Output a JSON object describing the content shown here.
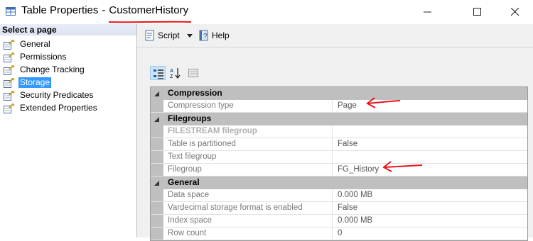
{
  "window": {
    "title_prefix": "Table Properties",
    "title_separator": "-",
    "title_object": "CustomerHistory"
  },
  "left_panel": {
    "header": "Select a page",
    "items": [
      {
        "label": "General",
        "icon": "wrench-page-icon",
        "selected": false
      },
      {
        "label": "Permissions",
        "icon": "wrench-page-icon",
        "selected": false
      },
      {
        "label": "Change Tracking",
        "icon": "wrench-page-icon",
        "selected": false
      },
      {
        "label": "Storage",
        "icon": "wrench-page-icon",
        "selected": true
      },
      {
        "label": "Security Predicates",
        "icon": "wrench-page-icon",
        "selected": false
      },
      {
        "label": "Extended Properties",
        "icon": "wrench-page-icon",
        "selected": false
      }
    ]
  },
  "toolbar": {
    "script_label": "Script",
    "help_label": "Help"
  },
  "property_grid": {
    "categories": [
      {
        "name": "Compression",
        "rows": [
          {
            "name": "Compression type",
            "value": "Page"
          }
        ]
      },
      {
        "name": "Filegroups",
        "rows": [
          {
            "name": "FILESTREAM filegroup",
            "value": ""
          },
          {
            "name": "Table is partitioned",
            "value": "False"
          },
          {
            "name": "Text filegroup",
            "value": ""
          },
          {
            "name": "Filegroup",
            "value": "FG_History"
          }
        ]
      },
      {
        "name": "General",
        "rows": [
          {
            "name": "Data space",
            "value": "0.000 MB"
          },
          {
            "name": "Vardecimal storage format is enabled",
            "value": "False"
          },
          {
            "name": "Index space",
            "value": "0.000 MB"
          },
          {
            "name": "Row count",
            "value": "0"
          }
        ]
      }
    ]
  },
  "colors": {
    "annotation": "#e8141c",
    "selection": "#3399ff",
    "category_band": "#bfbfbf"
  }
}
